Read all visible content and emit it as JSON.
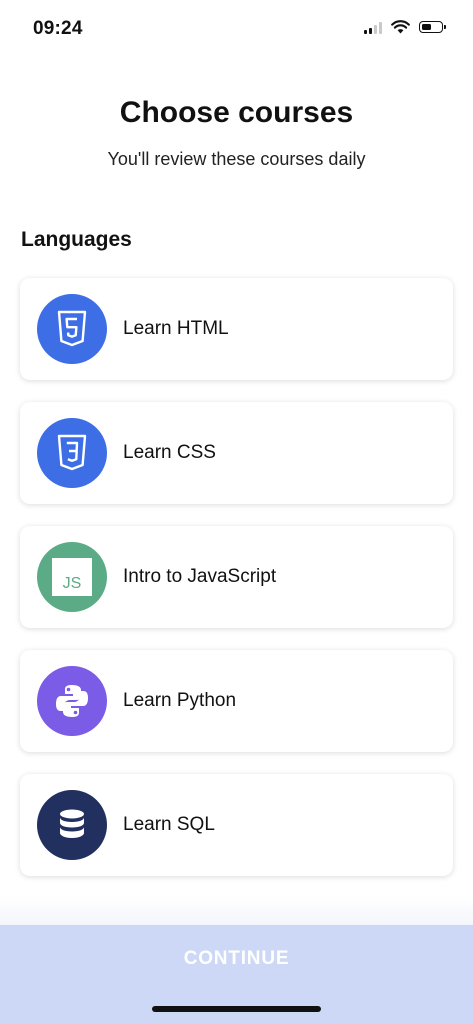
{
  "status_bar": {
    "time": "09:24",
    "signal_icon": "cellular-signal-icon",
    "wifi_icon": "wifi-icon",
    "battery_icon": "battery-icon",
    "battery_level": 0.5
  },
  "header": {
    "title": "Choose courses",
    "subtitle": "You'll review these courses daily"
  },
  "section": {
    "title": "Languages"
  },
  "courses": [
    {
      "label": "Learn HTML",
      "icon": "html5-icon",
      "color": "#3d6ee6"
    },
    {
      "label": "Learn CSS",
      "icon": "css3-icon",
      "color": "#3d6ee6"
    },
    {
      "label": "Intro to JavaScript",
      "icon": "javascript-icon",
      "icon_text": "JS",
      "color": "#5aab86"
    },
    {
      "label": "Learn Python",
      "icon": "python-icon",
      "color": "#7b5ce6"
    },
    {
      "label": "Learn SQL",
      "icon": "database-icon",
      "color": "#21305e"
    }
  ],
  "footer": {
    "continue_label": "CONTINUE",
    "button_color": "#cdd8f6"
  }
}
